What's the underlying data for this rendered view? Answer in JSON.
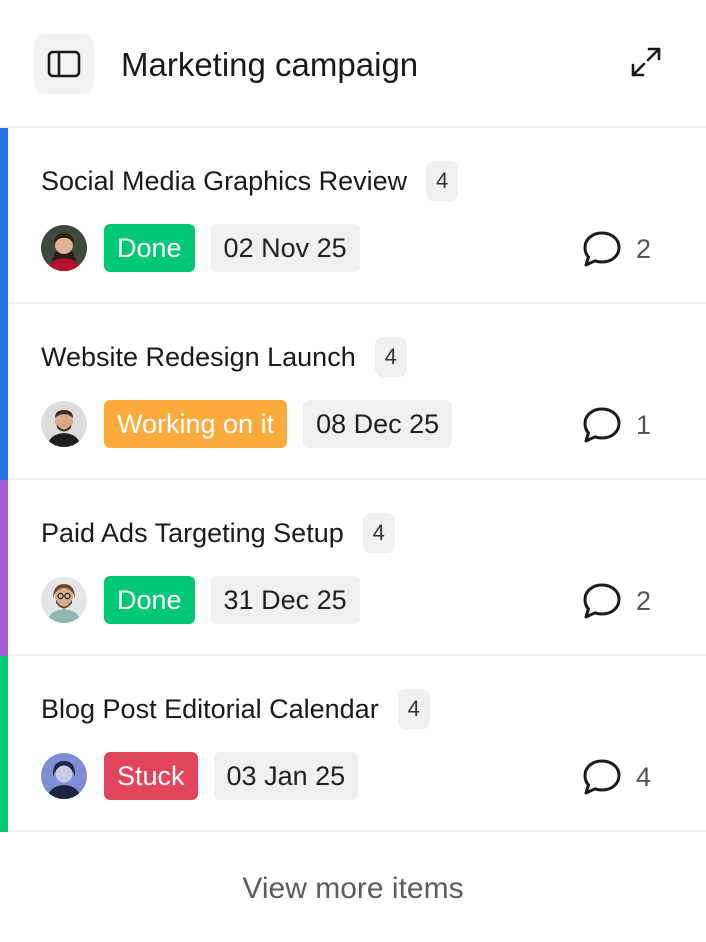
{
  "header": {
    "title": "Marketing campaign",
    "sidebar_icon": "sidebar-toggle-icon",
    "expand_icon": "expand-icon"
  },
  "colors": {
    "done": "#00c875",
    "working_on_it": "#fdab3d",
    "stuck": "#e2445c",
    "group_blue": "#2372e2",
    "group_purple": "#a25ddc",
    "group_green": "#00c875"
  },
  "items": [
    {
      "title": "Social Media Graphics Review",
      "subitems": "4",
      "status": "Done",
      "date": "02 Nov 25",
      "comments": "2"
    },
    {
      "title": "Website Redesign Launch",
      "subitems": "4",
      "status": "Working on it",
      "date": "08 Dec 25",
      "comments": "1"
    },
    {
      "title": "Paid Ads Targeting Setup",
      "subitems": "4",
      "status": "Done",
      "date": "31 Dec 25",
      "comments": "2"
    },
    {
      "title": "Blog Post Editorial Calendar",
      "subitems": "4",
      "status": "Stuck",
      "date": "03 Jan 25",
      "comments": "4"
    }
  ],
  "footer": {
    "view_more_label": "View more items"
  }
}
